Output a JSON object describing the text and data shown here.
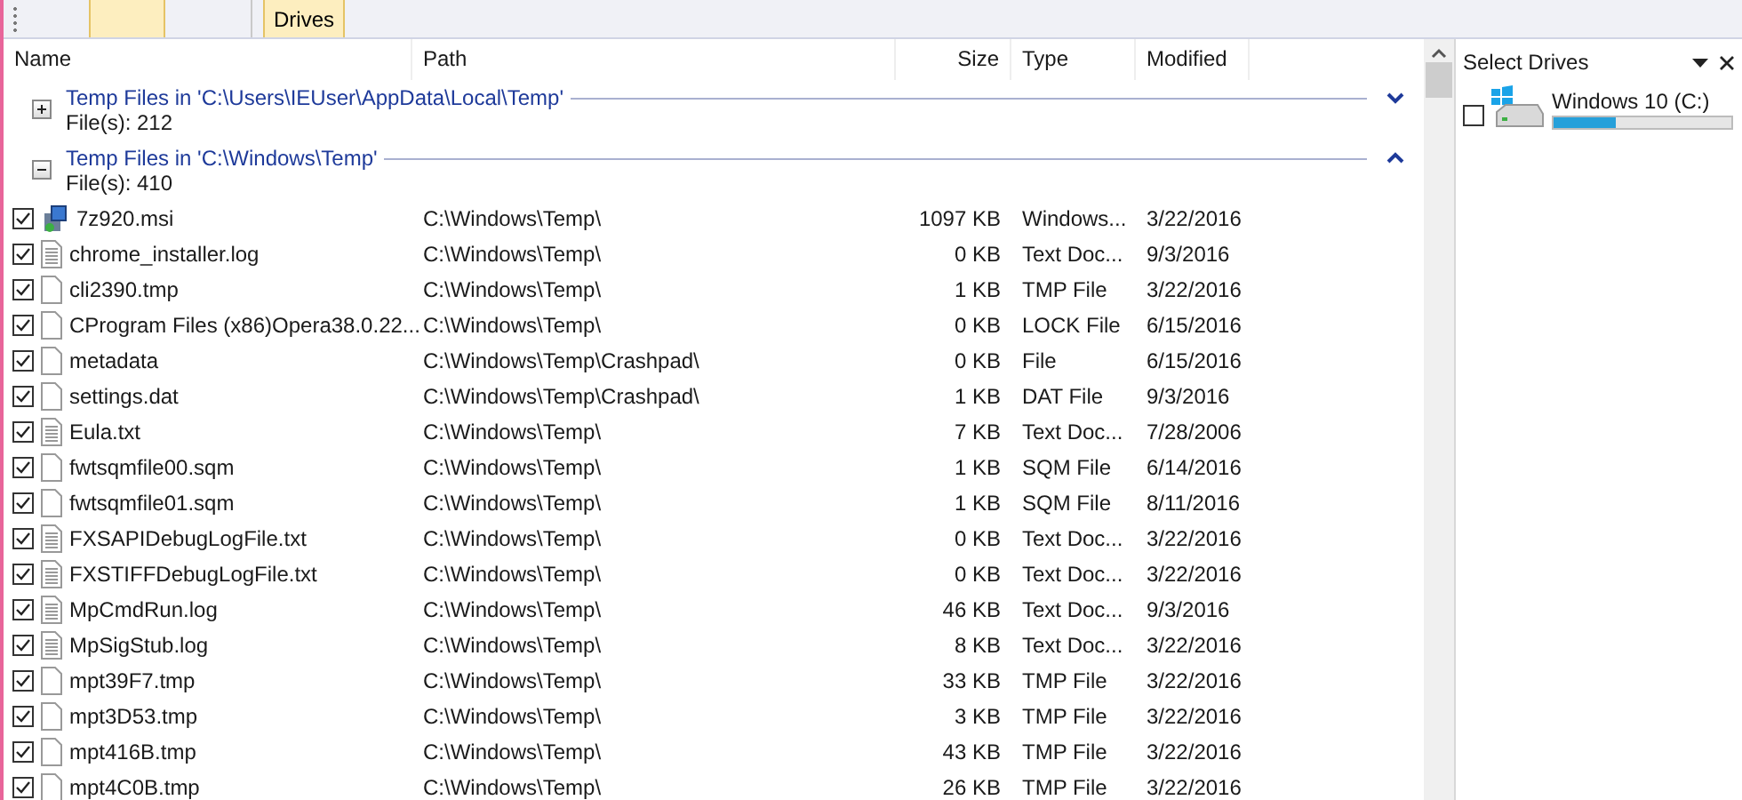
{
  "toolbar": {
    "tabs": [
      {
        "selected": true
      },
      {
        "selected": false
      },
      {
        "label": "Drives",
        "selected": true
      }
    ]
  },
  "columns": [
    "Name",
    "Path",
    "Size",
    "Type",
    "Modified"
  ],
  "groups": [
    {
      "title": "Temp Files in 'C:\\Users\\IEUser\\AppData\\Local\\Temp'",
      "count": "File(s): 212",
      "expanded": false
    },
    {
      "title": "Temp Files in 'C:\\Windows\\Temp'",
      "count": "File(s): 410",
      "expanded": true,
      "files": [
        {
          "name": "7z920.msi",
          "kind": "installer",
          "checked": true,
          "path": "C:\\Windows\\Temp\\",
          "size": "1097 KB",
          "type": "Windows...",
          "modified": "3/22/2016"
        },
        {
          "name": "chrome_installer.log",
          "kind": "text",
          "checked": true,
          "path": "C:\\Windows\\Temp\\",
          "size": "0 KB",
          "type": "Text Doc...",
          "modified": "9/3/2016"
        },
        {
          "name": "cli2390.tmp",
          "kind": "blank",
          "checked": true,
          "path": "C:\\Windows\\Temp\\",
          "size": "1 KB",
          "type": "TMP File",
          "modified": "3/22/2016"
        },
        {
          "name": "CProgram Files (x86)Opera38.0.22...",
          "kind": "blank",
          "checked": true,
          "path": "C:\\Windows\\Temp\\",
          "size": "0 KB",
          "type": "LOCK File",
          "modified": "6/15/2016"
        },
        {
          "name": "metadata",
          "kind": "blank",
          "checked": true,
          "path": "C:\\Windows\\Temp\\Crashpad\\",
          "size": "0 KB",
          "type": "File",
          "modified": "6/15/2016"
        },
        {
          "name": "settings.dat",
          "kind": "blank",
          "checked": true,
          "path": "C:\\Windows\\Temp\\Crashpad\\",
          "size": "1 KB",
          "type": "DAT File",
          "modified": "9/3/2016"
        },
        {
          "name": "Eula.txt",
          "kind": "text",
          "checked": true,
          "path": "C:\\Windows\\Temp\\",
          "size": "7 KB",
          "type": "Text Doc...",
          "modified": "7/28/2006"
        },
        {
          "name": "fwtsqmfile00.sqm",
          "kind": "blank",
          "checked": true,
          "path": "C:\\Windows\\Temp\\",
          "size": "1 KB",
          "type": "SQM File",
          "modified": "6/14/2016"
        },
        {
          "name": "fwtsqmfile01.sqm",
          "kind": "blank",
          "checked": true,
          "path": "C:\\Windows\\Temp\\",
          "size": "1 KB",
          "type": "SQM File",
          "modified": "8/11/2016"
        },
        {
          "name": "FXSAPIDebugLogFile.txt",
          "kind": "text",
          "checked": true,
          "path": "C:\\Windows\\Temp\\",
          "size": "0 KB",
          "type": "Text Doc...",
          "modified": "3/22/2016"
        },
        {
          "name": "FXSTIFFDebugLogFile.txt",
          "kind": "text",
          "checked": true,
          "path": "C:\\Windows\\Temp\\",
          "size": "0 KB",
          "type": "Text Doc...",
          "modified": "3/22/2016"
        },
        {
          "name": "MpCmdRun.log",
          "kind": "text",
          "checked": true,
          "path": "C:\\Windows\\Temp\\",
          "size": "46 KB",
          "type": "Text Doc...",
          "modified": "9/3/2016"
        },
        {
          "name": "MpSigStub.log",
          "kind": "text",
          "checked": true,
          "path": "C:\\Windows\\Temp\\",
          "size": "8 KB",
          "type": "Text Doc...",
          "modified": "3/22/2016"
        },
        {
          "name": "mpt39F7.tmp",
          "kind": "blank",
          "checked": true,
          "path": "C:\\Windows\\Temp\\",
          "size": "33 KB",
          "type": "TMP File",
          "modified": "3/22/2016"
        },
        {
          "name": "mpt3D53.tmp",
          "kind": "blank",
          "checked": true,
          "path": "C:\\Windows\\Temp\\",
          "size": "3 KB",
          "type": "TMP File",
          "modified": "3/22/2016"
        },
        {
          "name": "mpt416B.tmp",
          "kind": "blank",
          "checked": true,
          "path": "C:\\Windows\\Temp\\",
          "size": "43 KB",
          "type": "TMP File",
          "modified": "3/22/2016"
        },
        {
          "name": "mpt4C0B.tmp",
          "kind": "blank",
          "checked": true,
          "path": "C:\\Windows\\Temp\\",
          "size": "26 KB",
          "type": "TMP File",
          "modified": "3/22/2016"
        }
      ]
    }
  ],
  "drives_panel": {
    "title": "Select Drives",
    "drives": [
      {
        "name": "Windows 10 (C:)",
        "checked": false,
        "level": 0.35
      }
    ]
  }
}
